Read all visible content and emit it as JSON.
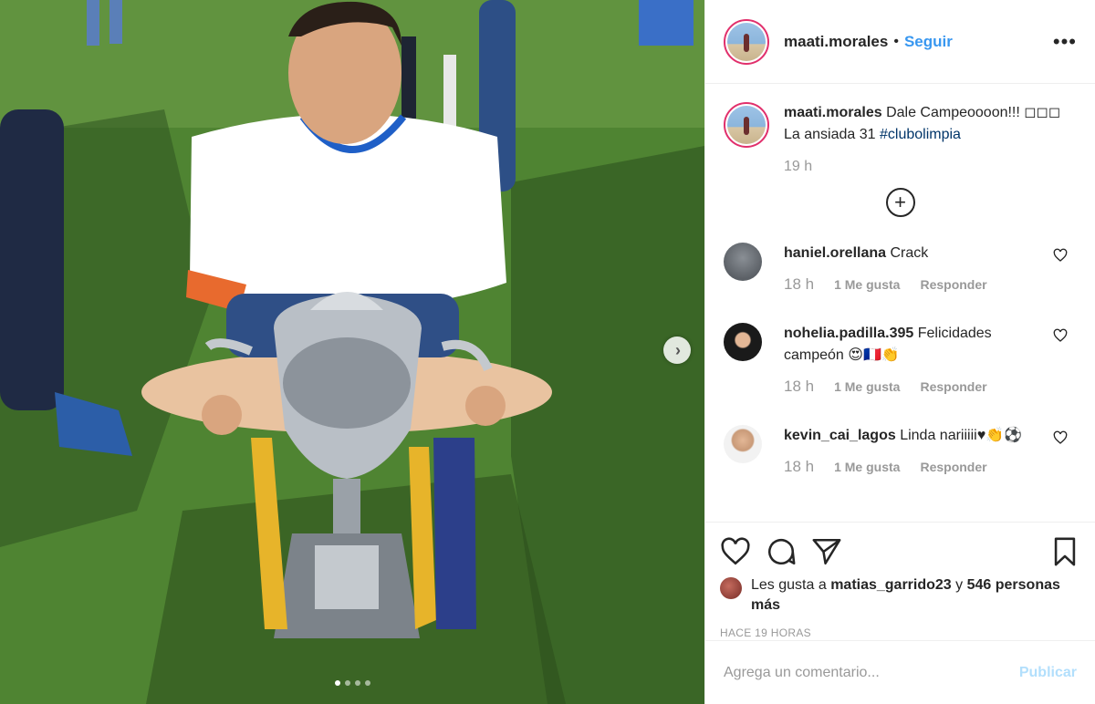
{
  "post": {
    "username": "maati.morales",
    "separator": "•",
    "follow_label": "Seguir",
    "more_icon": "more-options-icon",
    "carousel": {
      "next_icon": "chevron-right-icon",
      "image_count": 4,
      "active_index": 0
    }
  },
  "caption": {
    "username": "maati.morales",
    "text": "Dale Campeoooon!!! ◻◻◻ La ansiada 31",
    "hashtag": "#clubolimpia",
    "time": "19 h",
    "load_more_icon": "plus-circle-icon"
  },
  "comments": [
    {
      "username": "haniel.orellana",
      "text": "Crack",
      "time": "18 h",
      "likes": "1 Me gusta",
      "reply": "Responder"
    },
    {
      "username": "nohelia.padilla.395",
      "text": "Felicidades campeón 😍🇫🇷👏",
      "time": "18 h",
      "likes": "1 Me gusta",
      "reply": "Responder"
    },
    {
      "username": "kevin_cai_lagos",
      "text": "Linda nariiiii♥👏⚽",
      "time": "18 h",
      "likes": "1 Me gusta",
      "reply": "Responder"
    }
  ],
  "actions": {
    "like_icon": "heart-icon",
    "comment_icon": "comment-icon",
    "share_icon": "paper-plane-icon",
    "save_icon": "bookmark-icon",
    "liked_prefix": "Les gusta a",
    "liked_user": "matias_garrido23",
    "liked_and": "y",
    "liked_others": "546 personas más",
    "posted_ago": "HACE 19 HORAS"
  },
  "add_comment": {
    "placeholder": "Agrega un comentario...",
    "publish_label": "Publicar"
  },
  "colors": {
    "accent": "#3897f0",
    "publish_disabled": "#b2dffc",
    "muted": "#999999",
    "ring": "#e1306c"
  }
}
